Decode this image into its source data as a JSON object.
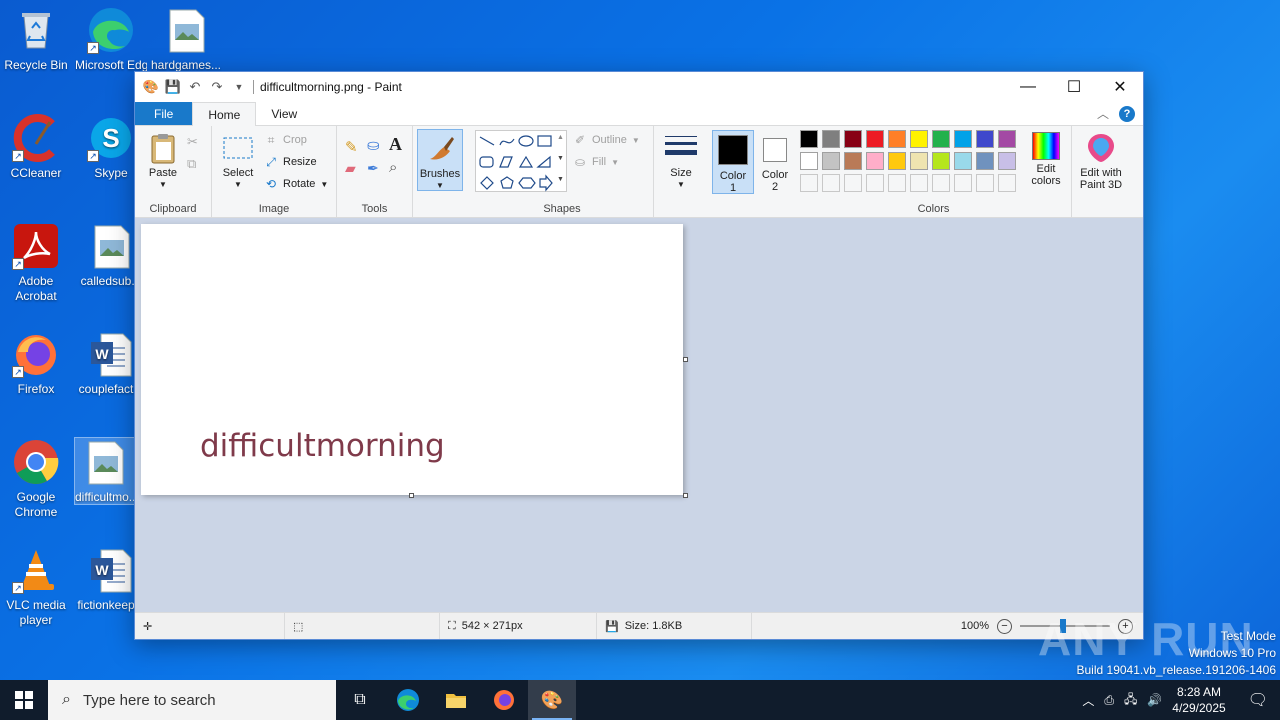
{
  "desktop": {
    "icons": [
      {
        "label": "Recycle Bin"
      },
      {
        "label": "Microsoft Edge",
        "label2": "Edge"
      },
      {
        "label": "hardgames..."
      },
      {
        "label": "CCleaner"
      },
      {
        "label": "Skype"
      },
      {
        "label": "Adobe",
        "label2": "Acrobat"
      },
      {
        "label": "calledsub..."
      },
      {
        "label": "Firefox"
      },
      {
        "label": "couplefact..."
      },
      {
        "label": "Google",
        "label2": "Chrome"
      },
      {
        "label": "difficultmo..."
      },
      {
        "label": "VLC media",
        "label2": "player"
      },
      {
        "label": "fictionkeep..."
      }
    ]
  },
  "window": {
    "title": "difficultmorning.png - Paint",
    "tabs": [
      "File",
      "Home",
      "View"
    ],
    "ribbon": {
      "clipboard": {
        "label": "Clipboard",
        "paste": "Paste"
      },
      "image": {
        "label": "Image",
        "select": "Select",
        "crop": "Crop",
        "resize": "Resize",
        "rotate": "Rotate"
      },
      "tools": {
        "label": "Tools"
      },
      "brushes": {
        "label": "Brushes"
      },
      "shapes": {
        "label": "Shapes",
        "outline": "Outline",
        "fill": "Fill"
      },
      "size": {
        "label": "Size"
      },
      "color1": {
        "label": "Color",
        "num": "1"
      },
      "color2": {
        "label": "Color",
        "num": "2"
      },
      "colors": {
        "label": "Colors",
        "edit": "Edit",
        "edit2": "colors"
      },
      "paint3d": {
        "label": "Edit with",
        "label2": "Paint 3D"
      }
    },
    "palette_row1": [
      "#000000",
      "#7f7f7f",
      "#880015",
      "#ed1c24",
      "#ff7f27",
      "#fff200",
      "#22b14c",
      "#00a2e8",
      "#3f48cc",
      "#a349a4"
    ],
    "palette_row2": [
      "#ffffff",
      "#c3c3c3",
      "#b97a57",
      "#ffaec9",
      "#ffc90e",
      "#efe4b0",
      "#b5e61d",
      "#99d9ea",
      "#7092be",
      "#c8bfe7"
    ],
    "canvas_text": "difficultmorning",
    "canvas_text_color": "#7f3a4a",
    "status": {
      "dimensions": "542 × 271px",
      "size": "Size: 1.8KB",
      "zoom": "100%"
    }
  },
  "watermark": {
    "brand": "ANY RUN",
    "line1": "Test Mode",
    "line2": "Windows 10 Pro",
    "line3": "Build 19041.vb_release.191206-1406"
  },
  "taskbar": {
    "search_placeholder": "Type here to search",
    "time": "8:28 AM",
    "date": "4/29/2025"
  }
}
